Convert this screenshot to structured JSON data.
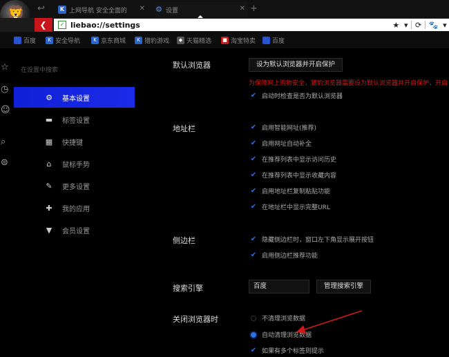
{
  "tabs": [
    {
      "label": "上网导航 安全全面的",
      "favicon": "K"
    },
    {
      "label": "设置",
      "favicon": "gear-icon"
    }
  ],
  "address": {
    "url": "liebao://settings"
  },
  "bookmarks": [
    {
      "label": "百度",
      "color": "#2c4fd1"
    },
    {
      "label": "安全导航",
      "favicon": "K",
      "color": "#2c63c6"
    },
    {
      "label": "京东商城",
      "favicon": "K",
      "color": "#2c63c6"
    },
    {
      "label": "猎豹游戏",
      "favicon": "K",
      "color": "#2c63c6"
    },
    {
      "label": "天猫精选",
      "color": "#555555"
    },
    {
      "label": "淘宝特卖",
      "color": "#c81d1d"
    },
    {
      "label": "百度",
      "color": "#2c4fd1"
    }
  ],
  "sidebar": {
    "search_placeholder": "在设置中搜索",
    "items": [
      {
        "label": "基本设置",
        "icon": "gear-icon"
      },
      {
        "label": "标签设置",
        "icon": "tab-icon"
      },
      {
        "label": "快捷键",
        "icon": "keyboard-icon"
      },
      {
        "label": "鼠标手势",
        "icon": "mouse-icon"
      },
      {
        "label": "更多设置",
        "icon": "wrench-icon"
      },
      {
        "label": "我的应用",
        "icon": "puzzle-icon"
      },
      {
        "label": "会员设置",
        "icon": "vip-icon"
      }
    ]
  },
  "default_browser": {
    "title": "默认浏览器",
    "button": "设为默认浏览器并开启保护",
    "warning": "为保障网上购物安全，猎豹浏览器需要设为默认浏览器并开启保护，开启",
    "check_label": "启动时检查是否为默认浏览器"
  },
  "addressbar_section": {
    "title": "地址栏",
    "options": [
      "启用智能网址(推荐)",
      "启用网址自动补全",
      "在推荐列表中显示访问历史",
      "在推荐列表中显示收藏内容",
      "启用地址栏复制粘贴功能",
      "在地址栏中显示完整URL"
    ]
  },
  "sidebar_section": {
    "title": "侧边栏",
    "options": [
      "隐藏侧边栏时，窗口左下角显示展开按钮",
      "启用侧边栏推荐功能"
    ]
  },
  "search_engine": {
    "title": "搜索引擎",
    "selected": "百度",
    "manage_button": "管理搜索引擎"
  },
  "on_close": {
    "title": "关闭浏览器时",
    "options": [
      {
        "label": "不清理浏览数据",
        "selected": false
      },
      {
        "label": "自动清理浏览数据",
        "selected": true
      },
      {
        "label": "如果有多个标签则提示",
        "selected": true
      }
    ]
  },
  "colors": {
    "accent": "#1a2ae6",
    "check": "#2f6ee8",
    "warning": "#c81d1d",
    "back_button": "#c7151c",
    "annotation_arrow": "#d01818"
  }
}
